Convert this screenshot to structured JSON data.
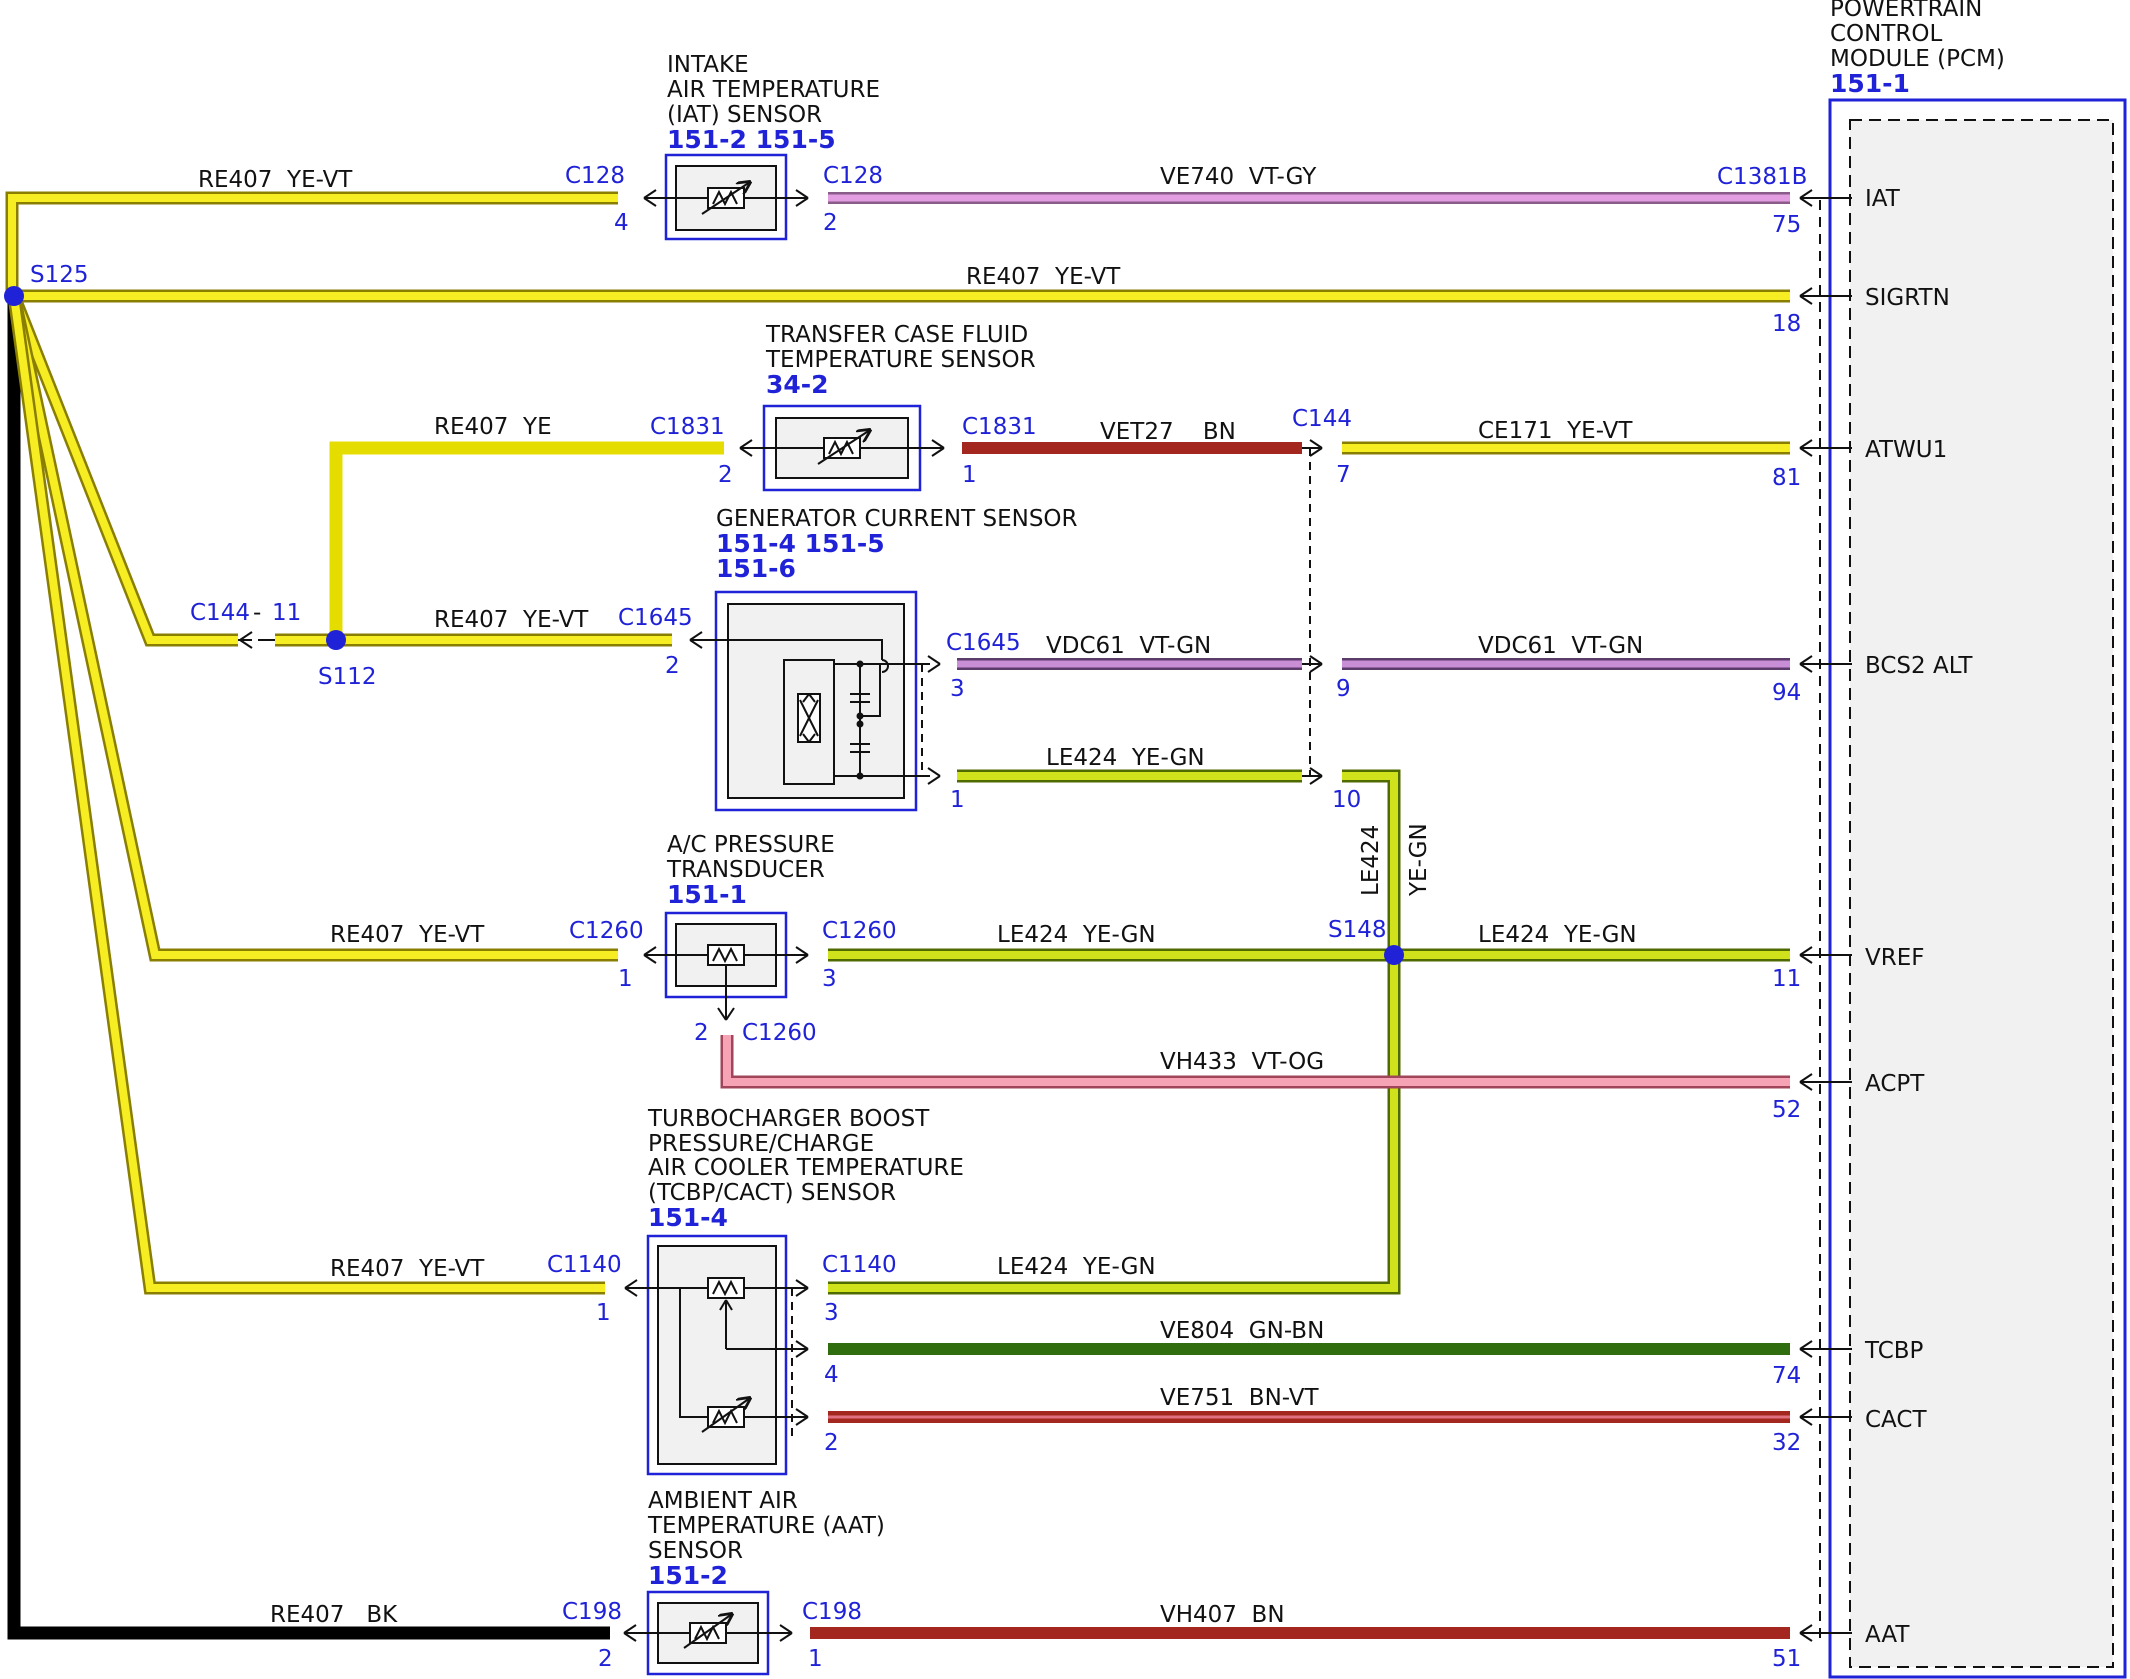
{
  "colors": {
    "yellow": "#f6ee22",
    "yellow_vt": "#d8c90c",
    "yellow_green": "#cfe21c",
    "violet_gray": "#e29ee0",
    "violet_green": "#c98fd6",
    "brown": "#a3261f",
    "pink": "#f5a3b5",
    "green": "#2f6d0f",
    "black": "#000000",
    "blue": "#1f22d6",
    "box_fill": "#f1f1f1"
  },
  "pcm": {
    "title_lines": [
      "POWERTRAIN",
      "CONTROL",
      "MODULE (PCM)"
    ],
    "ref": "151-1",
    "signals": [
      "IAT",
      "SIGRTN",
      "ATWU1",
      "BCS2 ALT",
      "VREF",
      "ACPT",
      "TCBP",
      "CACT",
      "AAT"
    ],
    "pins": [
      "75",
      "18",
      "81",
      "94",
      "11",
      "52",
      "74",
      "32",
      "51"
    ],
    "connector": "C1381B"
  },
  "splices": {
    "s125": "S125",
    "s112": "S112",
    "s148": "S148"
  },
  "components": {
    "iat": {
      "lines": [
        "INTAKE",
        "AIR TEMPERATURE",
        "(IAT) SENSOR"
      ],
      "ref": "151-2 151-5"
    },
    "tcft": {
      "lines": [
        "TRANSFER CASE FLUID",
        "TEMPERATURE SENSOR"
      ],
      "ref": "34-2"
    },
    "gcs": {
      "lines": [
        "GENERATOR CURRENT SENSOR"
      ],
      "ref1": "151-4 151-5",
      "ref2": "151-6"
    },
    "acp": {
      "lines": [
        "A/C PRESSURE",
        "TRANSDUCER"
      ],
      "ref": "151-1"
    },
    "tcbp": {
      "lines": [
        "TURBOCHARGER BOOST",
        "PRESSURE/CHARGE",
        "AIR COOLER TEMPERATURE",
        "(TCBP/CACT) SENSOR"
      ],
      "ref": "151-4"
    },
    "aat": {
      "lines": [
        "AMBIENT AIR",
        "TEMPERATURE (AAT)",
        "SENSOR"
      ],
      "ref": "151-2"
    }
  },
  "wires": {
    "w1": "RE407  YE-VT",
    "w2": "VE740  VT-GY",
    "w3": "RE407  YE-VT",
    "w4": "RE407  YE",
    "w5": "VET27    BN",
    "w6": "CE171  YE-VT",
    "w7": "RE407  YE-VT",
    "w8": "VDC61  VT-GN",
    "w9": "VDC61  VT-GN",
    "w10": "LE424  YE-GN",
    "w11": "LE424",
    "w11b": "YE-GN",
    "w12": "RE407  YE-VT",
    "w13": "LE424  YE-GN",
    "w14": "LE424  YE-GN",
    "w15": "VH433  VT-OG",
    "w16": "RE407  YE-VT",
    "w17": "LE424  YE-GN",
    "w18": "VE804  GN-BN",
    "w19": "VE751  BN-VT",
    "w20": "RE407   BK",
    "w21": "VH407  BN"
  },
  "connectors": {
    "c128a": "C128",
    "c128b": "C128",
    "c1831a": "C1831",
    "c1831b": "C1831",
    "c144a": "C144",
    "c144b": "C144",
    "c1645a": "C1645",
    "c1645b": "C1645",
    "c1260a": "C1260",
    "c1260b": "C1260",
    "c1260c": "C1260",
    "c1140a": "C1140",
    "c1140b": "C1140",
    "c198a": "C198",
    "c198b": "C198"
  },
  "pins": {
    "p4": "4",
    "p2a": "2",
    "p2b": "2",
    "p1a": "1",
    "p7": "7",
    "p11": "11",
    "dash": "-",
    "p2c": "2",
    "p3a": "3",
    "p9": "9",
    "p1b": "1",
    "p10": "10",
    "p1c": "1",
    "p3b": "3",
    "p2d": "2",
    "p1d": "1",
    "p3c": "3",
    "p4b": "4",
    "p2e": "2",
    "p2f": "2",
    "p1e": "1"
  }
}
